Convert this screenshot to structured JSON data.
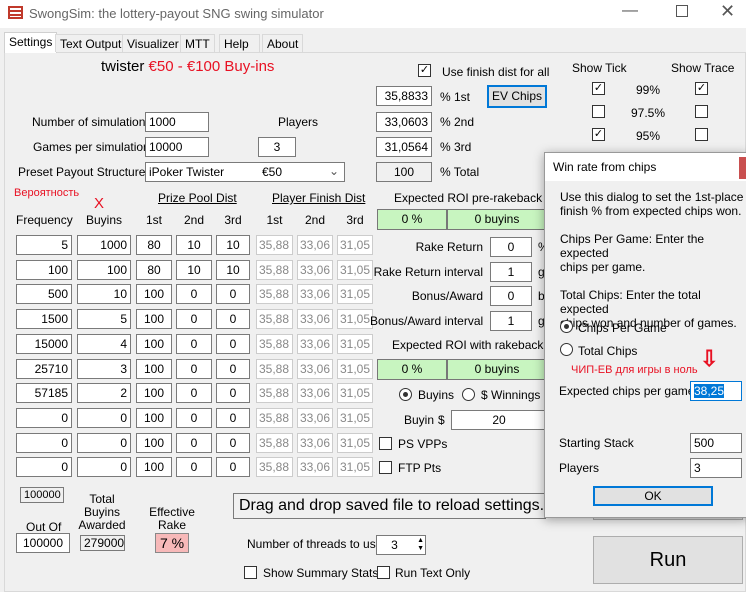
{
  "window": {
    "title": "SwongSim: the lottery-payout SNG swing simulator"
  },
  "tabs": [
    "Settings",
    "Text Output",
    "Visualizer",
    "MTT",
    "Help",
    "About"
  ],
  "header": {
    "prefix": "twister ",
    "highlight": "€50 - €100 Buy-ins",
    "accent": "#e81123"
  },
  "use_finish_dist": {
    "label": "Use finish dist for all",
    "checked": true
  },
  "finish": {
    "p1": "35,8833",
    "p2": "33,0603",
    "p3": "31,0564",
    "total": "100",
    "l1": "% 1st",
    "l2": "% 2nd",
    "l3": "% 3rd",
    "lt": "% Total"
  },
  "ev_chips": "EV Chips",
  "sims": {
    "label": "Number of simulations",
    "value": "1000"
  },
  "games": {
    "label": "Games per simulation",
    "value": "10000"
  },
  "players": {
    "label": "Players",
    "value": "3"
  },
  "preset": {
    "label": "Preset Payout Structures",
    "value": "iPoker Twister",
    "value2": "€50"
  },
  "confidence": {
    "tick_header": "Show Tick",
    "trace_header": "Show Trace",
    "rows": [
      {
        "label": "99%",
        "tick": true,
        "trace": true
      },
      {
        "label": "97.5%",
        "tick": false,
        "trace": false
      },
      {
        "label": "95%",
        "tick": true,
        "trace": false
      }
    ]
  },
  "table": {
    "annotation": "Вероятность",
    "x_mark": "X",
    "prize_header": "Prize Pool Dist",
    "finish_header": "Player Finish Dist",
    "cols": [
      "Frequency",
      "Buyins",
      "1st",
      "2nd",
      "3rd",
      "1st",
      "2nd",
      "3rd"
    ],
    "rows": [
      [
        "5",
        "1000",
        "80",
        "10",
        "10"
      ],
      [
        "100",
        "100",
        "80",
        "10",
        "10"
      ],
      [
        "500",
        "10",
        "100",
        "0",
        "0"
      ],
      [
        "1500",
        "5",
        "100",
        "0",
        "0"
      ],
      [
        "15000",
        "4",
        "100",
        "0",
        "0"
      ],
      [
        "25710",
        "3",
        "100",
        "0",
        "0"
      ],
      [
        "57185",
        "2",
        "100",
        "0",
        "0"
      ],
      [
        "0",
        "0",
        "100",
        "0",
        "0"
      ],
      [
        "0",
        "0",
        "100",
        "0",
        "0"
      ],
      [
        "0",
        "0",
        "100",
        "0",
        "0"
      ]
    ],
    "finish_values": [
      "35,88",
      "33,06",
      "31,05"
    ]
  },
  "roi_pre": {
    "label": "Expected ROI pre-rakeback",
    "pct": "0 %",
    "buyins": "0 buyins"
  },
  "rake_return": {
    "label": "Rake Return",
    "value": "0",
    "unit": "%"
  },
  "rake_interval": {
    "label": "Rake Return interval",
    "value": "1",
    "unit": "g"
  },
  "bonus": {
    "label": "Bonus/Award",
    "value": "0",
    "unit": "b"
  },
  "bonus_interval": {
    "label": "Bonus/Award interval",
    "value": "1",
    "unit": "g"
  },
  "roi_with": {
    "label": "Expected ROI with rakeback",
    "pct": "0 %",
    "buyins": "0 buyins"
  },
  "units": {
    "buyins": "Buyins",
    "winnings": "$ Winnings",
    "selected": "Buyins"
  },
  "buyin": {
    "label": "Buyin",
    "currency": "$",
    "value": "20"
  },
  "ps_vpps": "PS VPPs",
  "ftp_pts": "FTP Pts",
  "totals": {
    "sum": "100000",
    "out_of_label": "Out Of",
    "out_of": "100000",
    "awarded_label1": "Total",
    "awarded_label2": "Buyins",
    "awarded_label3": "Awarded",
    "awarded": "279000",
    "rake_label1": "Effective",
    "rake_label2": "Rake",
    "rake": "7 %"
  },
  "dragdrop": "Drag and drop saved file to reload settings.",
  "threads": {
    "label": "Number of threads to use",
    "value": "3"
  },
  "summary_stats": "Show Summary Stats",
  "run_text_only": "Run Text Only",
  "run": "Run",
  "dialog": {
    "title": "Win rate from chips",
    "desc1": "Use this dialog to set the 1st-place",
    "desc2": "finish % from expected chips won.",
    "cpg1": "Chips Per Game:  Enter the expected",
    "cpg2": "chips per game.",
    "tc1": "Total Chips:  Enter the total expected",
    "tc2": "chips won and number of games.",
    "opt1": "Chips Per Game",
    "opt2": "Total Chips",
    "annotation": "ЧИП-ЕВ для игры в ноль",
    "exp_label": "Expected chips per game",
    "exp_value": "38,25",
    "stack_label": "Starting Stack",
    "stack": "500",
    "players_label": "Players",
    "players": "3",
    "ok": "OK"
  }
}
